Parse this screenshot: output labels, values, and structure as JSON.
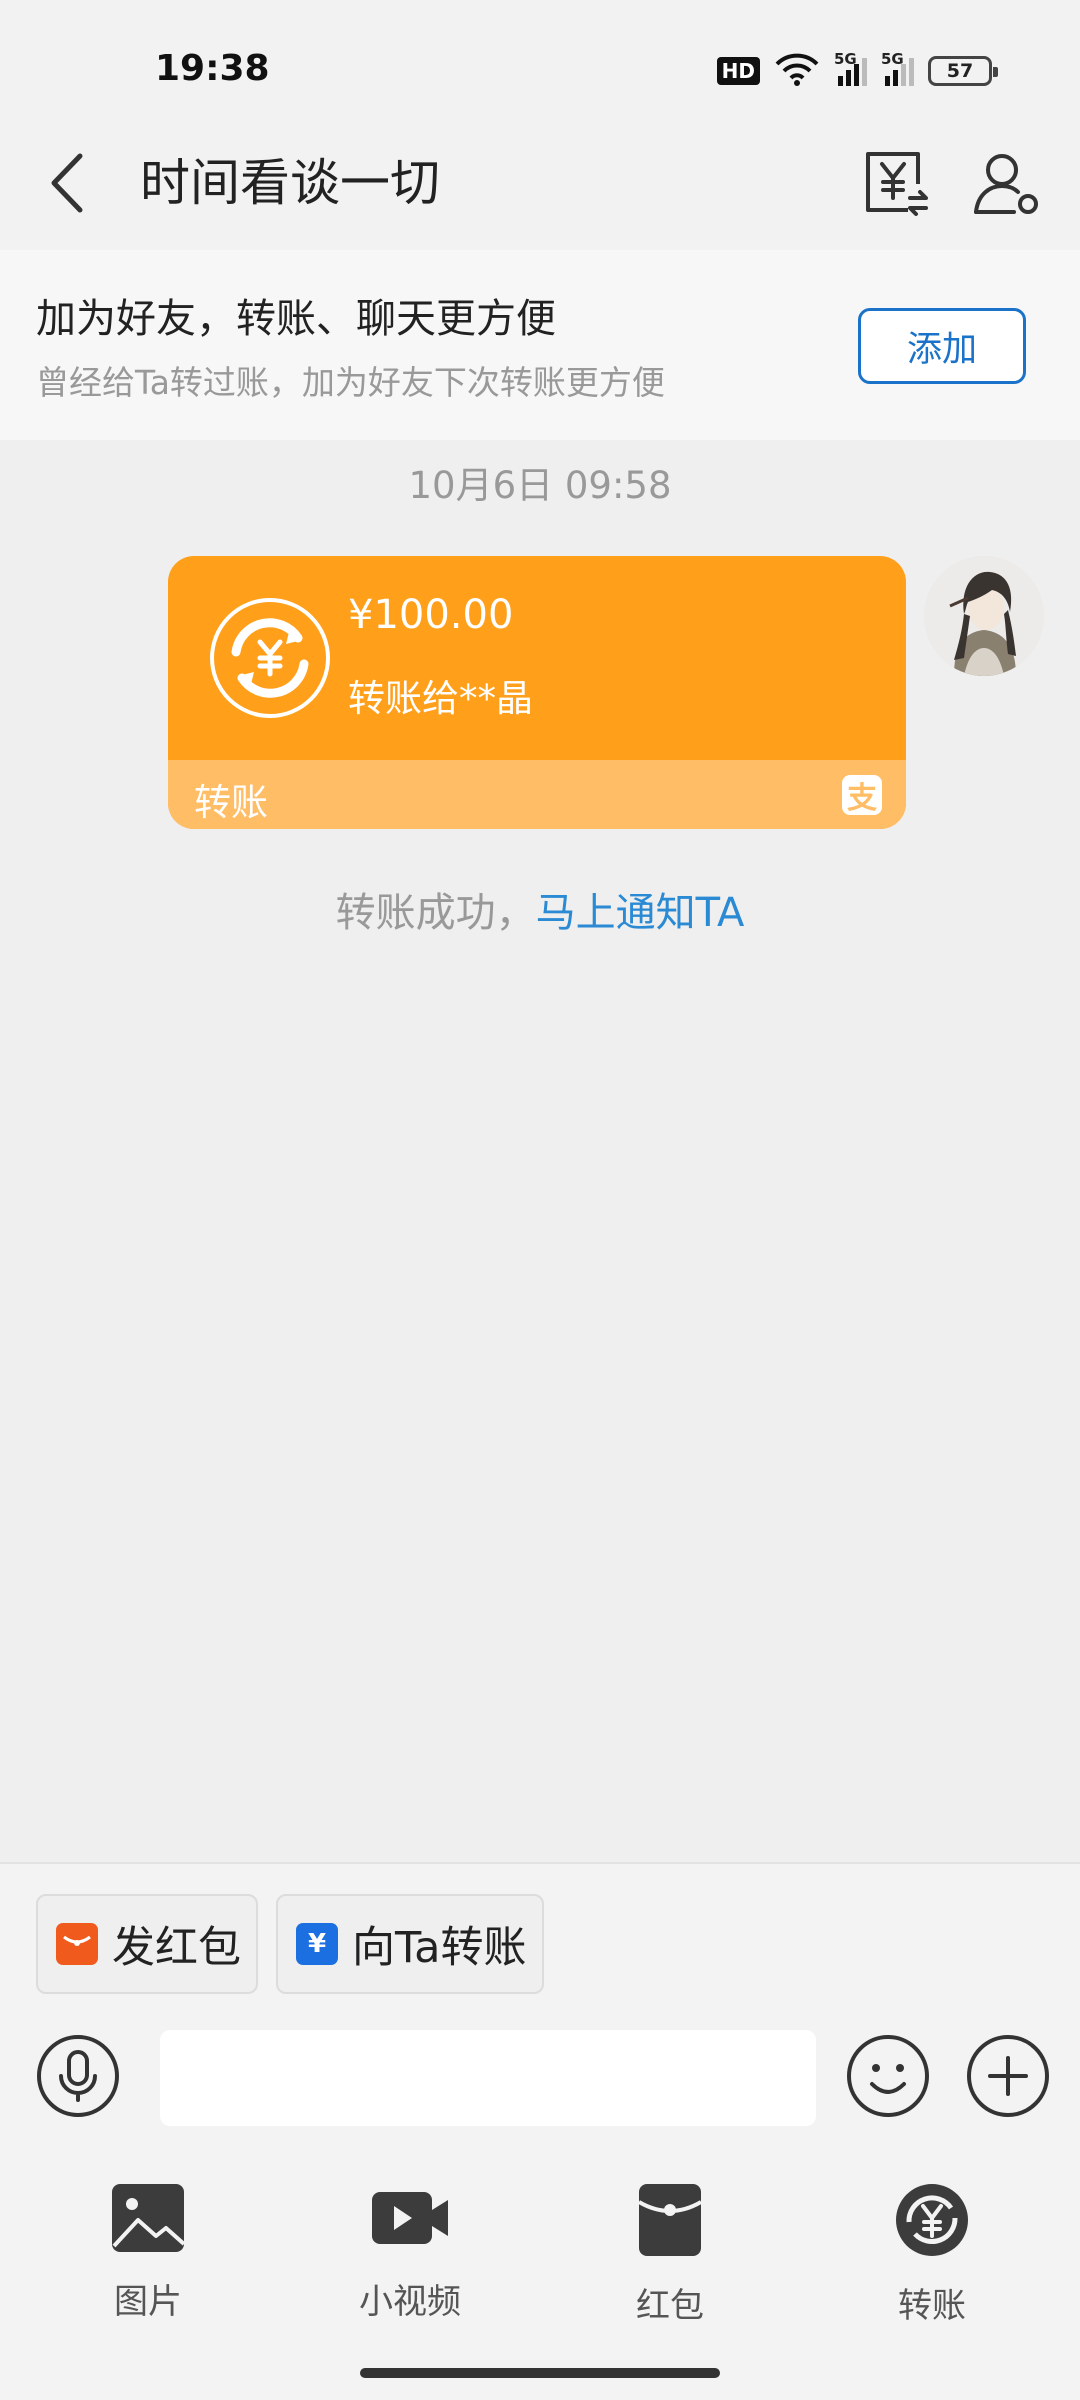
{
  "status_bar": {
    "time": "19:38",
    "hd_label": "HD",
    "signal_1": "5G",
    "signal_2": "5G",
    "battery": "57"
  },
  "header": {
    "title": "时间看谈一切",
    "back_icon": "chevron-left-icon",
    "transfer_record_icon": "yuan-transfer-icon",
    "profile_icon": "user-settings-icon"
  },
  "add_banner": {
    "title": "加为好友，转账、聊天更方便",
    "subtitle": "曾经给Ta转过账，加为好友下次转账更方便",
    "button_label": "添加"
  },
  "messages": {
    "date_stamp": "10月6日 09:58",
    "transfer": {
      "amount": "¥100.00",
      "recipient": "转账给**晶",
      "type_label": "转账",
      "brand_icon": "alipay-icon",
      "brand_glyph": "支",
      "card_color": "#ff9f1a",
      "footer_color": "#ffbd66"
    },
    "notice_text": "转账成功，",
    "notice_link": "马上通知TA"
  },
  "quick_actions": {
    "red_packet": "发红包",
    "transfer_to": "向Ta转账"
  },
  "input": {
    "placeholder": ""
  },
  "tools": {
    "photos": "图片",
    "video": "小视频",
    "red_packet": "红包",
    "transfer": "转账"
  },
  "colors": {
    "accent_blue": "#1a73c8",
    "link_blue": "#2a8ad4",
    "transfer_orange": "#ff9f1a"
  }
}
